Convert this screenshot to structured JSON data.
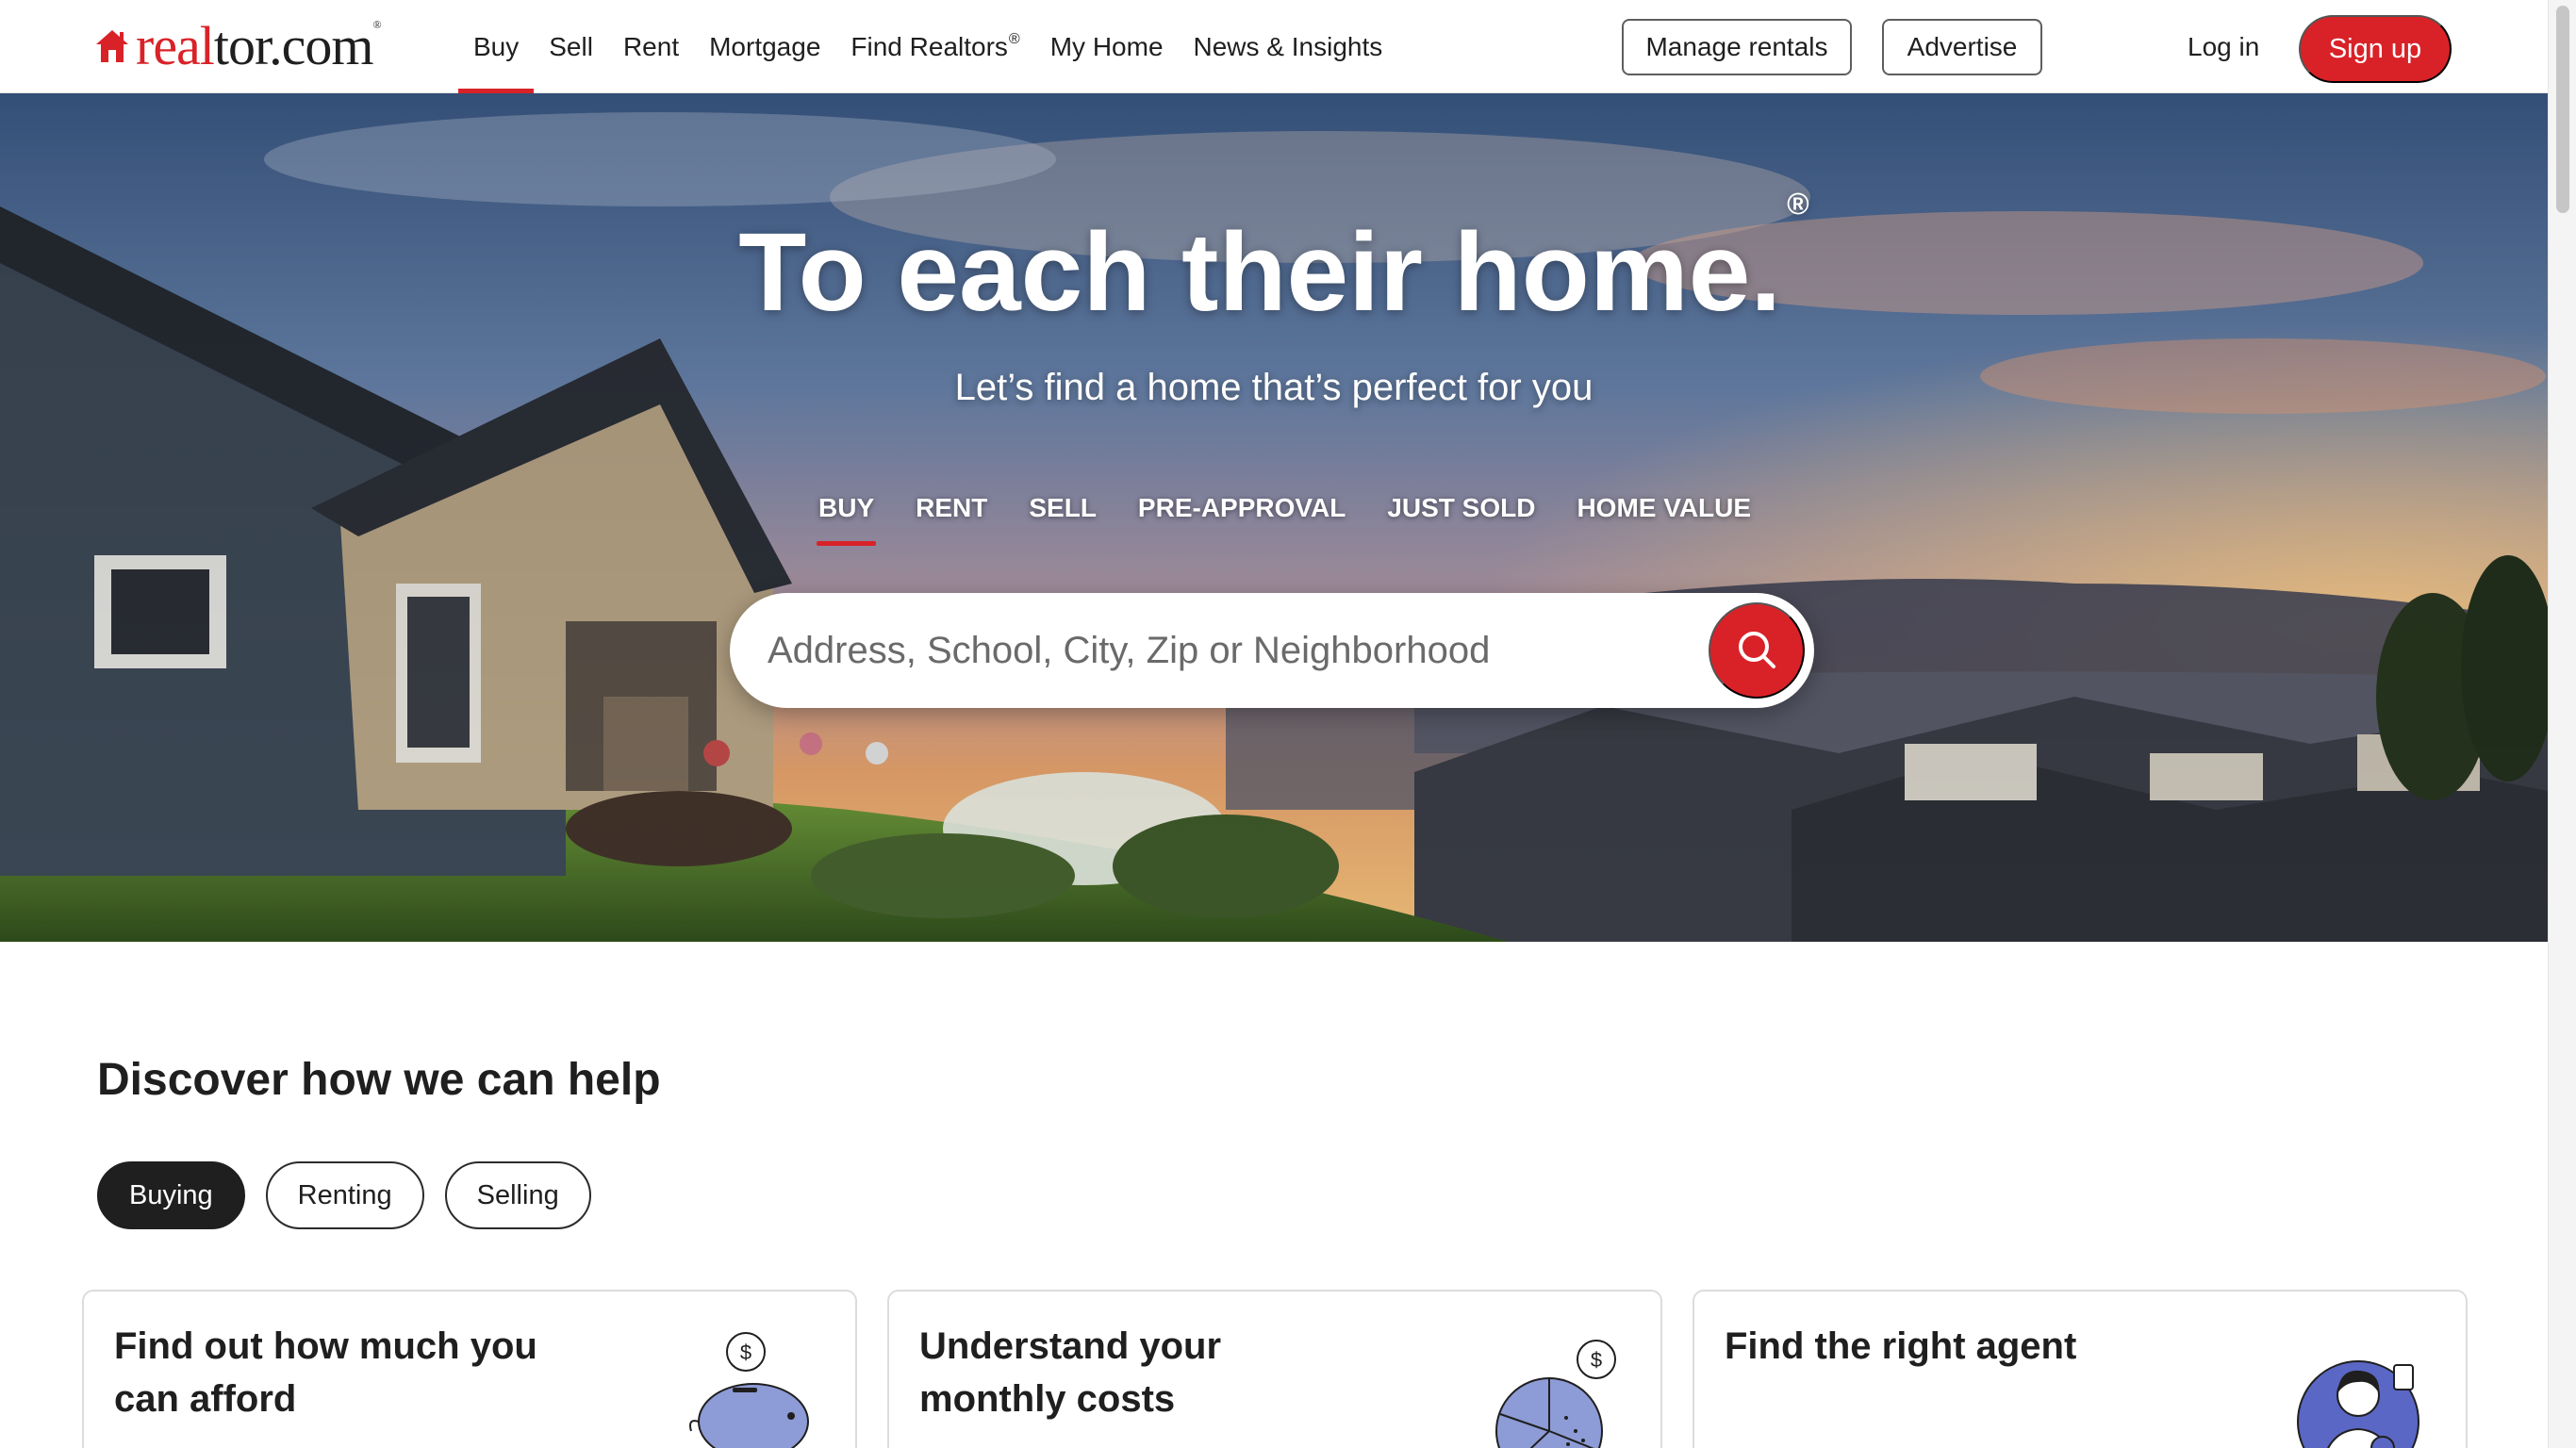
{
  "brand": {
    "logo_part1": "real",
    "logo_part2": "tor.com",
    "logo_reg": "®",
    "accent_color": "#d92228"
  },
  "nav": {
    "items": [
      {
        "label": "Buy",
        "active": true
      },
      {
        "label": "Sell"
      },
      {
        "label": "Rent"
      },
      {
        "label": "Mortgage"
      },
      {
        "label": "Find Realtors",
        "sup": "®"
      },
      {
        "label": "My Home"
      },
      {
        "label": "News & Insights"
      }
    ],
    "manage_rentals": "Manage rentals",
    "advertise": "Advertise",
    "login": "Log in",
    "signup": "Sign up"
  },
  "hero": {
    "title": "To each their home.",
    "title_reg": "®",
    "subtitle": "Let’s find a home that’s perfect for you",
    "tabs": [
      {
        "label": "BUY",
        "active": true
      },
      {
        "label": "RENT"
      },
      {
        "label": "SELL"
      },
      {
        "label": "PRE-APPROVAL"
      },
      {
        "label": "JUST SOLD"
      },
      {
        "label": "HOME VALUE"
      }
    ],
    "search_placeholder": "Address, School, City, Zip or Neighborhood",
    "search_icon": "search-icon"
  },
  "discover": {
    "title": "Discover how we can help",
    "pills": [
      {
        "label": "Buying",
        "active": true
      },
      {
        "label": "Renting"
      },
      {
        "label": "Selling"
      }
    ],
    "cards": [
      {
        "title": "Find out how much you can afford",
        "icon": "piggy-bank-icon"
      },
      {
        "title": "Understand your monthly costs",
        "icon": "pie-chart-coin-icon"
      },
      {
        "title": "Find the right agent",
        "icon": "agent-avatar-icon"
      }
    ]
  }
}
